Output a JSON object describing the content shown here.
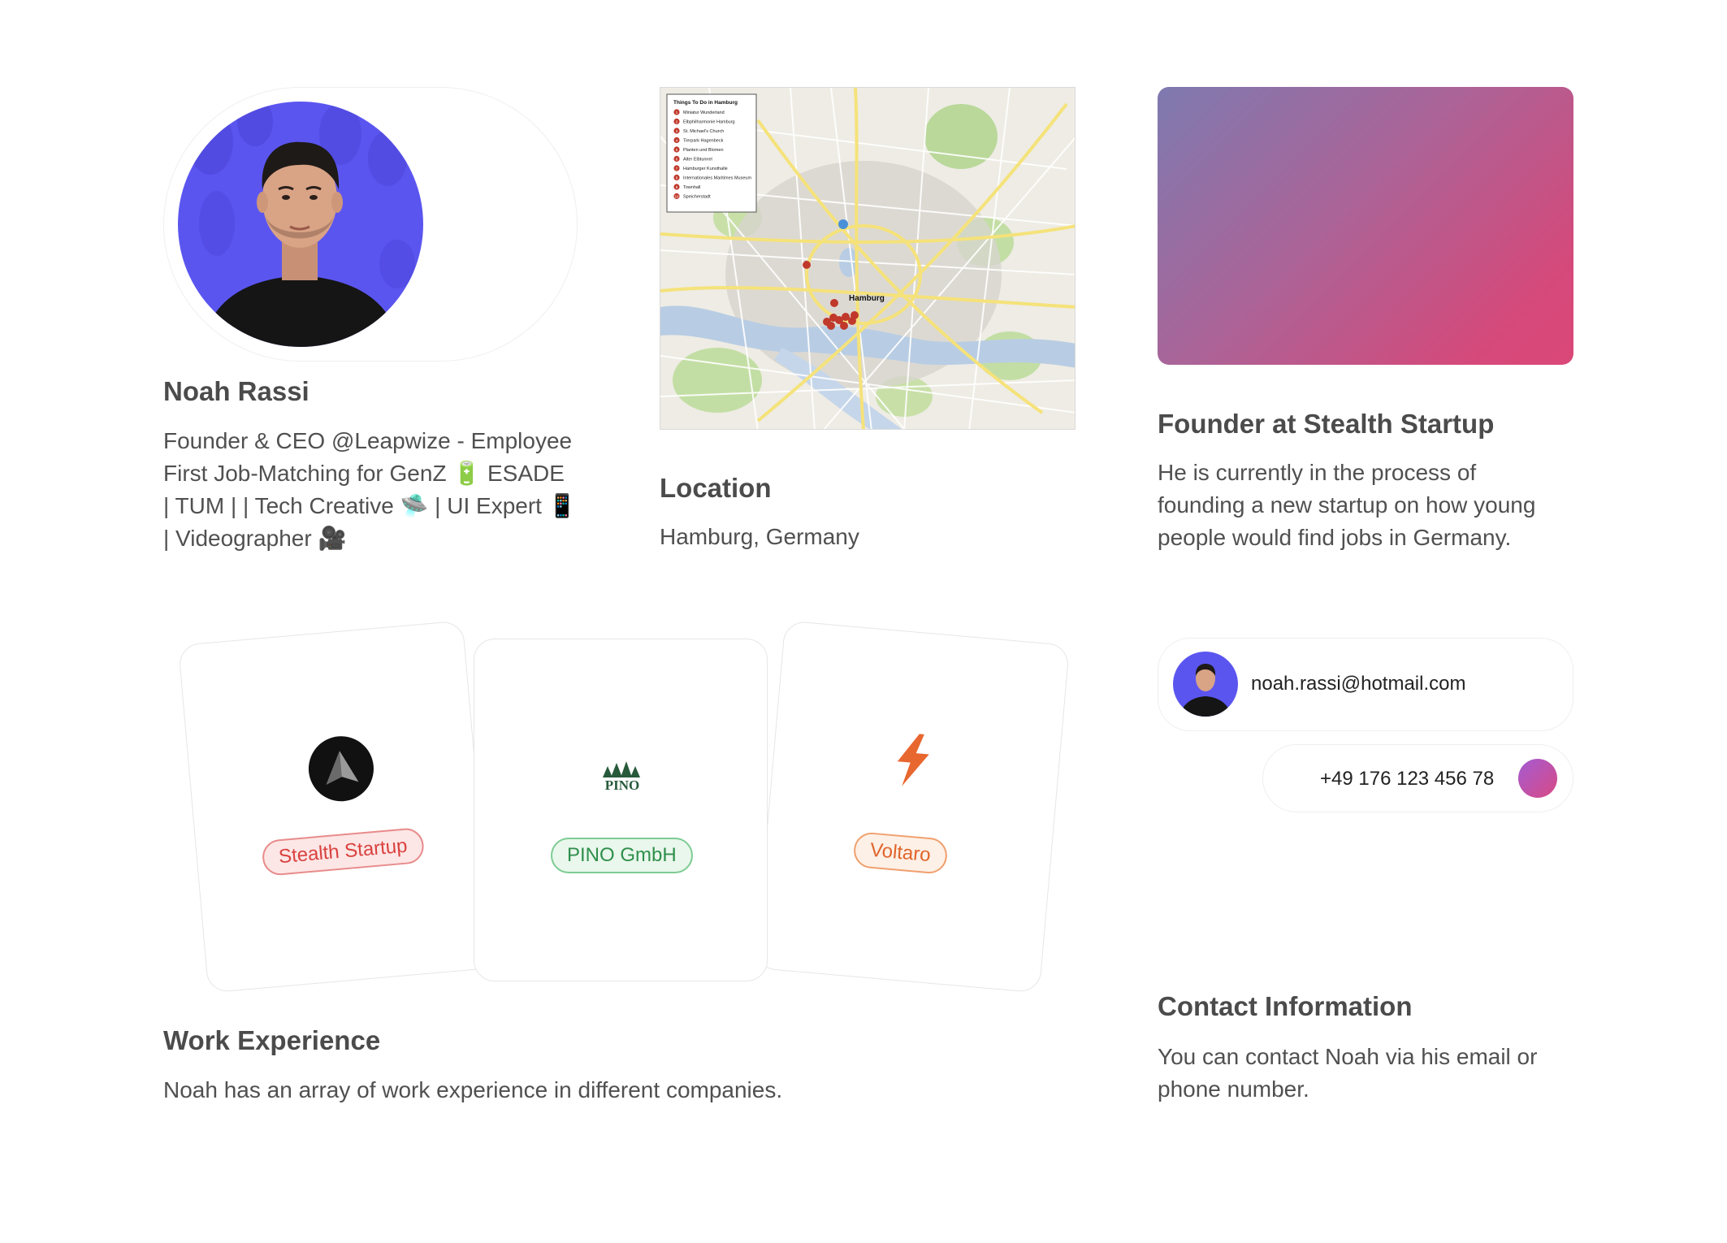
{
  "profile": {
    "name": "Noah Rassi",
    "bio_lines": [
      "Founder & CEO @Leapwize - Employee",
      "First Job-Matching for GenZ 🔋 ESADE",
      "| TUM | | Tech Creative 🛸 | UI Expert 📱",
      "| Videographer 🎥"
    ]
  },
  "location": {
    "title": "Location",
    "value": "Hamburg, Germany",
    "map": {
      "legend_title": "Things To Do in Hamburg",
      "legend_items": [
        "Miniatur Wunderland",
        "Elbphilharmonie Hamburg",
        "St. Michael's Church",
        "Tierpark Hagenbeck",
        "Planten und Blomen",
        "Alter Elbtunnel",
        "Hamburger Kunsthalle",
        "Internationales Maritimes Museum",
        "Townhall",
        "Speicherstadt"
      ],
      "city_label": "Hamburg"
    }
  },
  "founder": {
    "title": "Founder at Stealth Startup",
    "description_lines": [
      "He is currently in the process of",
      "founding a new startup on how young",
      "people would find jobs in Germany."
    ],
    "gradient_colors": [
      "#7e7ab0",
      "#d5497a"
    ]
  },
  "work": {
    "title": "Work Experience",
    "description": "Noah has an array of work experience in different companies.",
    "companies": [
      {
        "name": "Stealth Startup",
        "icon": "stealth-logo-icon",
        "color": "#d9423f"
      },
      {
        "name": "PINO GmbH",
        "icon": "pino-logo-icon",
        "logo_text": "PINO",
        "color": "#2f8f4c"
      },
      {
        "name": "Voltaro",
        "icon": "lightning-bolt-icon",
        "color": "#e0642a"
      }
    ]
  },
  "contact": {
    "title": "Contact Information",
    "description_lines": [
      "You can contact Noah via his email or",
      "phone number."
    ],
    "email": "noah.rassi@hotmail.com",
    "phone": "+49 176 123 456 78"
  }
}
